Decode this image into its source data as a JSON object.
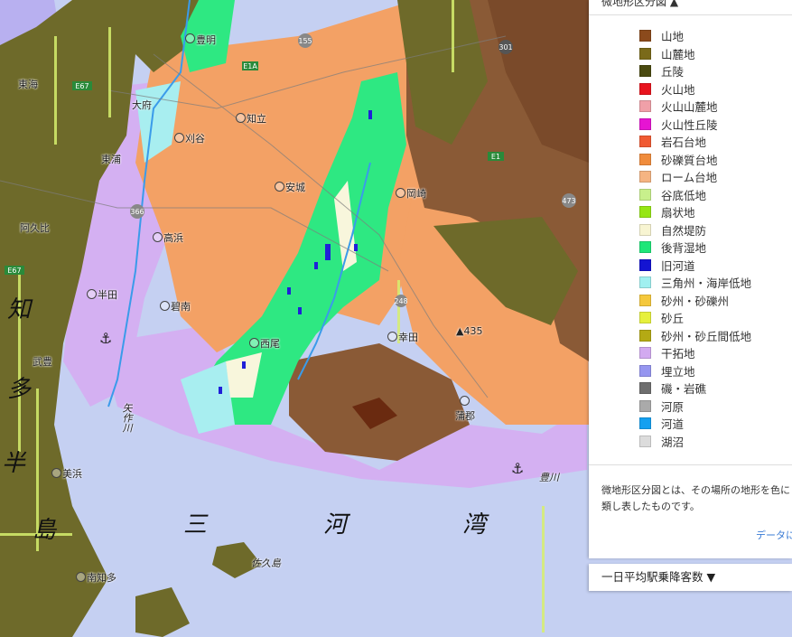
{
  "legend": {
    "header": "微地形区分図 ▲",
    "items": [
      {
        "label": "山地",
        "color": "#8b4a1c"
      },
      {
        "label": "山麓地",
        "color": "#7a6a1a"
      },
      {
        "label": "丘陵",
        "color": "#4a4a10"
      },
      {
        "label": "火山地",
        "color": "#e8141e"
      },
      {
        "label": "火山山麓地",
        "color": "#f0a0a8"
      },
      {
        "label": "火山性丘陵",
        "color": "#e614d2"
      },
      {
        "label": "岩石台地",
        "color": "#f05a32"
      },
      {
        "label": "砂礫質台地",
        "color": "#f08c3c"
      },
      {
        "label": "ローム台地",
        "color": "#f5b482"
      },
      {
        "label": "谷底低地",
        "color": "#c8f08c"
      },
      {
        "label": "扇状地",
        "color": "#96e614"
      },
      {
        "label": "自然堤防",
        "color": "#f8f5d2"
      },
      {
        "label": "後背湿地",
        "color": "#1ee678"
      },
      {
        "label": "旧河道",
        "color": "#1414d2"
      },
      {
        "label": "三角州・海岸低地",
        "color": "#a0f0f0"
      },
      {
        "label": "砂州・砂礫州",
        "color": "#f5c83c"
      },
      {
        "label": "砂丘",
        "color": "#e6f03c"
      },
      {
        "label": "砂州・砂丘間低地",
        "color": "#b4aa14"
      },
      {
        "label": "干拓地",
        "color": "#d2aaf0"
      },
      {
        "label": "埋立地",
        "color": "#9696f0"
      },
      {
        "label": "磯・岩礁",
        "color": "#6e6e6e"
      },
      {
        "label": "河原",
        "color": "#aaaaaa"
      },
      {
        "label": "河道",
        "color": "#14a0f0"
      },
      {
        "label": "湖沼",
        "color": "#dcdcdc"
      }
    ],
    "description_line1": "微地形区分図とは、その場所の地形を色に",
    "description_line2": "類し表したものです。",
    "link_text": "データに"
  },
  "passenger_panel": {
    "label": "一日平均駅乗降客数 ▼"
  },
  "map": {
    "bay_label": [
      "三",
      "河",
      "湾"
    ],
    "peninsula_chars": [
      "知",
      "多",
      "半",
      "島"
    ],
    "places": {
      "toyoake": "豊明",
      "chiryu": "知立",
      "kariya": "刈谷",
      "anjo": "安城",
      "okazaki": "岡崎",
      "takahama": "高浜",
      "handa": "半田",
      "hekinan": "碧南",
      "nishio": "西尾",
      "kota": "幸田",
      "agui": "阿久比",
      "taketoyo": "武豊",
      "mihama": "美浜",
      "minamichita": "南知多",
      "sakushima": "佐久島",
      "yahagigawa": "矢作川",
      "toyokawa": "豊川",
      "gamagori": "蒲郡",
      "higashiura": "東浦",
      "tokai": "東海",
      "obu": "大府",
      "peak": "▲435"
    }
  }
}
